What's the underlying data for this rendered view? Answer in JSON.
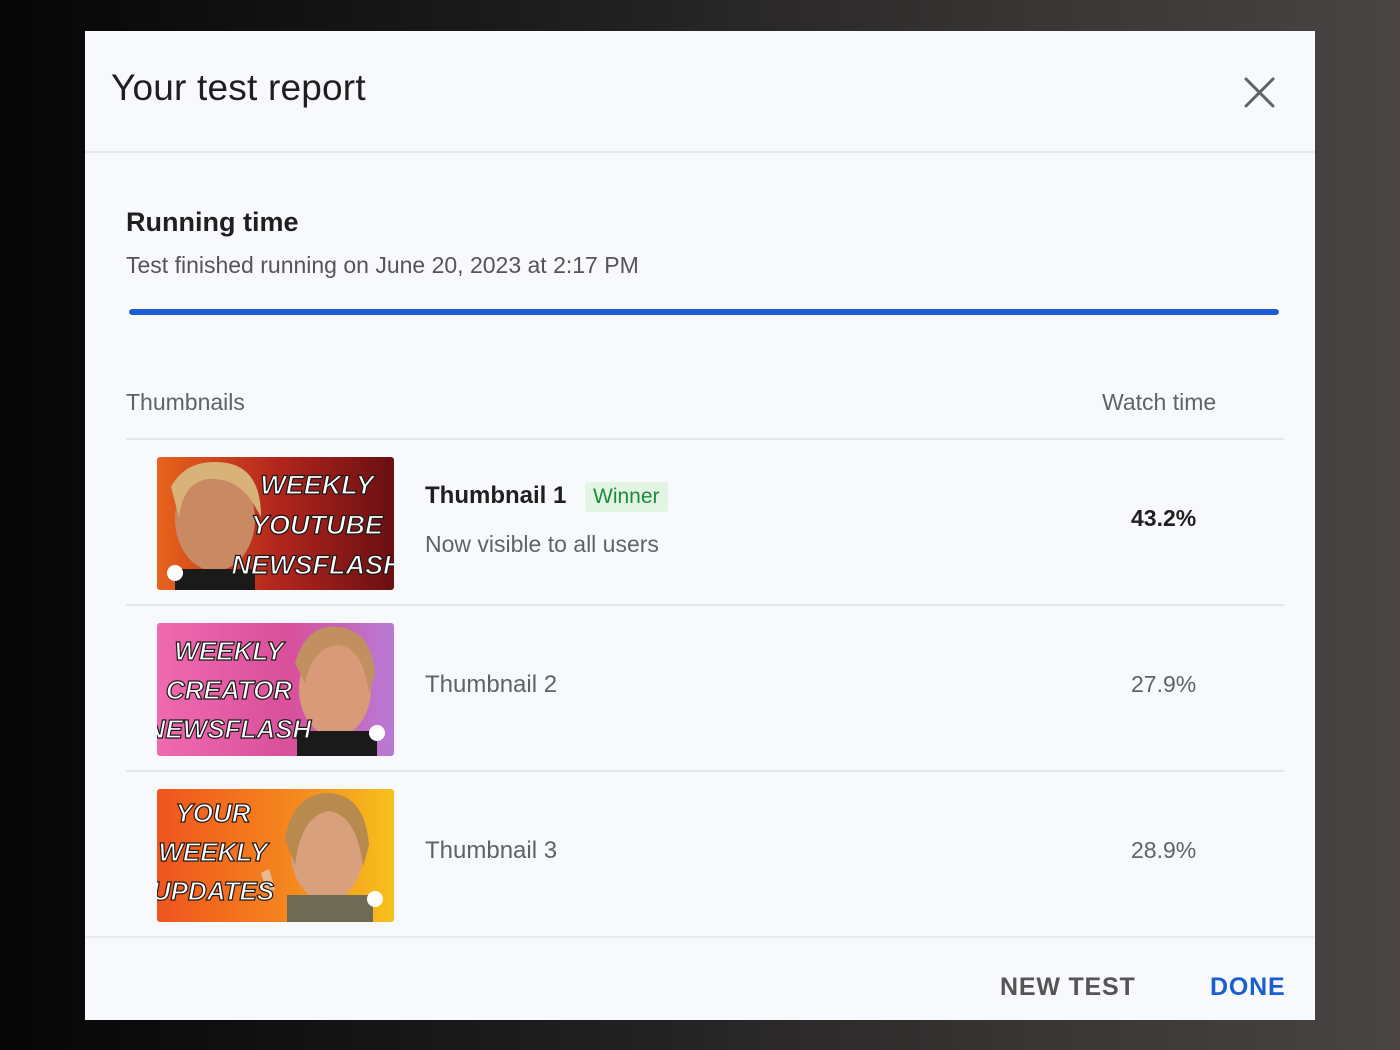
{
  "dialog": {
    "title": "Your test report"
  },
  "running_time": {
    "heading": "Running time",
    "subtitle": "Test finished running on June 20, 2023 at 2:17 PM",
    "progress": 1.0
  },
  "table": {
    "col_thumbnails": "Thumbnails",
    "col_watch_time": "Watch time",
    "rows": [
      {
        "name": "Thumbnail 1",
        "badge": "Winner",
        "status": "Now visible to all users",
        "watch_time": "43.2%",
        "thumb_lines": [
          "WEEKLY",
          "YOUTUBE",
          "NEWSFLASH"
        ]
      },
      {
        "name": "Thumbnail 2",
        "watch_time": "27.9%",
        "thumb_lines": [
          "WEEKLY",
          "CREATOR",
          "NEWSFLASH"
        ]
      },
      {
        "name": "Thumbnail 3",
        "watch_time": "28.9%",
        "thumb_lines": [
          "YOUR",
          "WEEKLY",
          "UPDATES"
        ]
      }
    ]
  },
  "footer": {
    "new_test_label": "NEW TEST",
    "done_label": "DONE"
  },
  "colors": {
    "accent": "#1c5fd4",
    "winner_bg": "#e2f4e3",
    "winner_text": "#1f8a3c"
  }
}
